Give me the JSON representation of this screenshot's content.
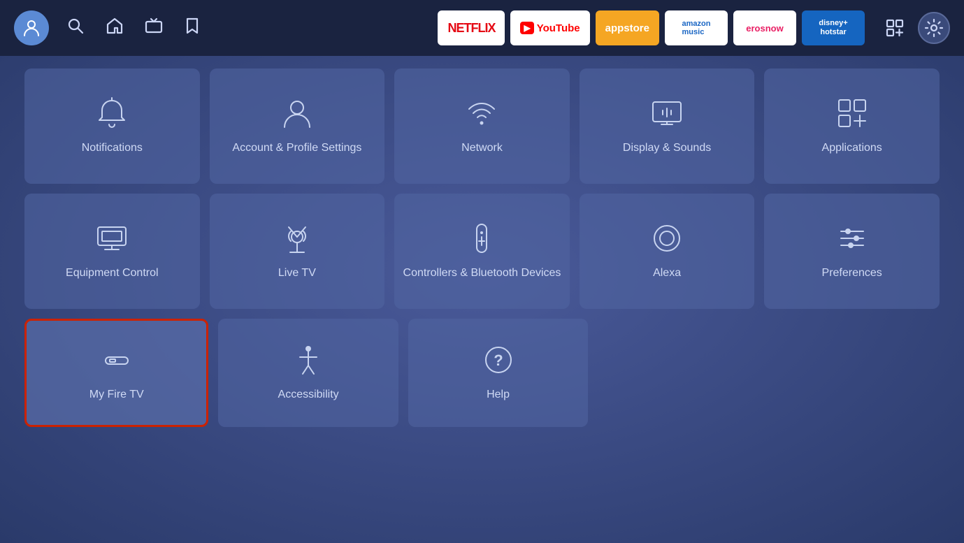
{
  "topnav": {
    "apps": [
      {
        "id": "netflix",
        "label": "NETFLIX",
        "class": "app-netflix"
      },
      {
        "id": "youtube",
        "label": "YouTube",
        "class": "app-youtube"
      },
      {
        "id": "appstore",
        "label": "appstore",
        "class": "app-appstore"
      },
      {
        "id": "amazon-music",
        "label": "amazon music",
        "class": "app-amazon-music"
      },
      {
        "id": "erosnow",
        "label": "erosnow",
        "class": "app-erosnow"
      },
      {
        "id": "hotstar",
        "label": "disney+ hotstar",
        "class": "app-hotstar"
      }
    ]
  },
  "grid": {
    "rows": [
      [
        {
          "id": "notifications",
          "label": "Notifications",
          "icon": "bell"
        },
        {
          "id": "account-profile",
          "label": "Account & Profile Settings",
          "icon": "person"
        },
        {
          "id": "network",
          "label": "Network",
          "icon": "wifi"
        },
        {
          "id": "display-sounds",
          "label": "Display & Sounds",
          "icon": "display"
        },
        {
          "id": "applications",
          "label": "Applications",
          "icon": "apps"
        }
      ],
      [
        {
          "id": "equipment-control",
          "label": "Equipment Control",
          "icon": "monitor"
        },
        {
          "id": "live-tv",
          "label": "Live TV",
          "icon": "antenna"
        },
        {
          "id": "controllers-bluetooth",
          "label": "Controllers & Bluetooth Devices",
          "icon": "remote"
        },
        {
          "id": "alexa",
          "label": "Alexa",
          "icon": "alexa"
        },
        {
          "id": "preferences",
          "label": "Preferences",
          "icon": "sliders"
        }
      ],
      [
        {
          "id": "my-fire-tv",
          "label": "My Fire TV",
          "icon": "firetv",
          "selected": true
        },
        {
          "id": "accessibility",
          "label": "Accessibility",
          "icon": "accessibility"
        },
        {
          "id": "help",
          "label": "Help",
          "icon": "help"
        },
        null,
        null
      ]
    ]
  }
}
